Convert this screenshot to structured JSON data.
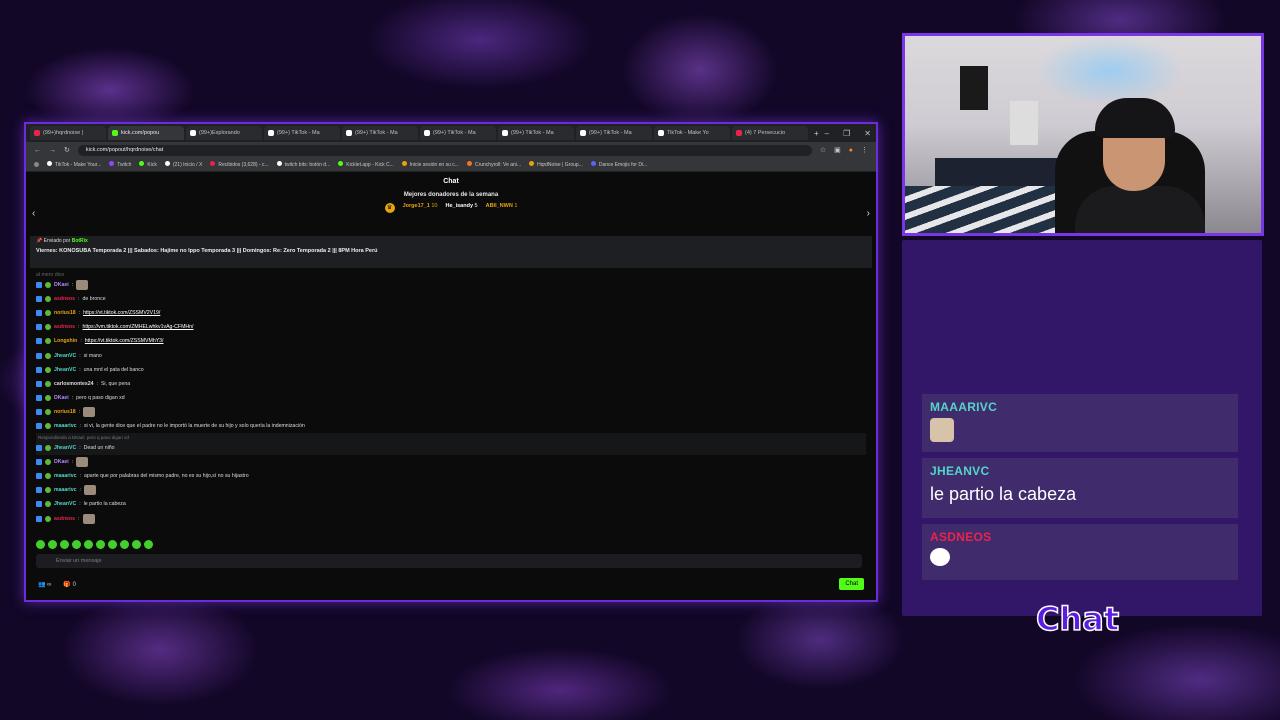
{
  "browser": {
    "tabs": [
      {
        "label": "(99+)hqrdnoise |"
      },
      {
        "label": "kick.com/popou",
        "active": true
      },
      {
        "label": "(99+)Explorando"
      },
      {
        "label": "(99+) TikTok - Ma"
      },
      {
        "label": "(99+) TikTok - Ma"
      },
      {
        "label": "(99+) TikTok - Ma"
      },
      {
        "label": "(99+) TikTok - Ma"
      },
      {
        "label": "(99+) TikTok - Ma"
      },
      {
        "label": "TikTok - Make Yo"
      },
      {
        "label": "(4) 7 Persecucio"
      }
    ],
    "new_tab": "+",
    "url": "kick.com/popout/hqrdnoise/chat",
    "bookmarks": [
      "TikTok - Make Your...",
      "Twitch",
      "Kick",
      "(21) Inicio / X",
      "Recibidos (3,628) - c...",
      "twitch bits: botón d...",
      "Kicklet.app - Kick C...",
      "Inicie sesión en su c...",
      "Crunchyroll: Ve ani...",
      "HqrdNoise | Group...",
      "Dance Emojis for Di..."
    ]
  },
  "chat": {
    "title": "Chat",
    "donors_title": "Mejores donadores de la semana",
    "donors": [
      {
        "name": "Jorge17_1",
        "amount": "10",
        "color": "#e8a40c"
      },
      {
        "name": "He_isandy",
        "amount": "5",
        "color": "#ffffff"
      },
      {
        "name": "ABII_NWN",
        "amount": "1",
        "color": "#e8a40c"
      }
    ],
    "cut_top": "al mero dice",
    "pinned": {
      "sent_by": "Enviado por",
      "bot": "BotRix",
      "message": "Viernes: KONOSUBA Temporada 2 ||| Sabados: Hajime no Ippo Temporada 3 ||| Domingos: Re: Zero Temporada 2 ||| 8PM Hora Perú"
    },
    "messages": [
      {
        "user": "DKaei",
        "color": "#b887ff",
        "text": "",
        "emote": true
      },
      {
        "user": "asdneos",
        "color": "#e8244d",
        "text": "de bronce"
      },
      {
        "user": "norius18",
        "color": "#e8a40c",
        "text": "https://vt.tiktok.com/ZSSMV2V19/",
        "link": true
      },
      {
        "user": "asdneos",
        "color": "#e8244d",
        "text": "https://vm.tiktok.com/ZMHELwhkv1vAg-CFMHn/",
        "link": true
      },
      {
        "user": "Longshin",
        "color": "#e8a40c",
        "text": "https://vt.tiktok.com/ZSSMVMhY3/",
        "link": true
      },
      {
        "user": "JheanVC",
        "color": "#53d6c8",
        "text": "si mano"
      },
      {
        "user": "JheanVC",
        "color": "#53d6c8",
        "text": "una mrd el pata del banco"
      },
      {
        "user": "carlosmontes24",
        "color": "#dddddd",
        "text": "Si, que pena"
      },
      {
        "user": "DKaei",
        "color": "#b887ff",
        "text": "pero q paso digan xd"
      },
      {
        "user": "norius18",
        "color": "#e8a40c",
        "text": "",
        "emote": true
      },
      {
        "user": "maaarivc",
        "color": "#53d6c8",
        "text": "si vi, la gente dice que el padre no le importó la muerte de su hijo y solo quería la indemnización"
      },
      {
        "user": "JheanVC",
        "color": "#53d6c8",
        "text": "Dead un niño",
        "reply": "Respondiendo a DKaei: pero q paso digan xd"
      },
      {
        "user": "DKaei",
        "color": "#b887ff",
        "text": "",
        "emote": true
      },
      {
        "user": "maaarivc",
        "color": "#53d6c8",
        "text": "aparte que por palabras del mismo padre, no es su hijo,sí no su hijastro"
      },
      {
        "user": "maaarivc",
        "color": "#53d6c8",
        "text": "",
        "emote": true
      },
      {
        "user": "JheanVC",
        "color": "#53d6c8",
        "text": "le partio la cabeza"
      },
      {
        "user": "asdneos",
        "color": "#e8244d",
        "text": "",
        "emote": true
      }
    ],
    "input_placeholder": "Enviar un mensaje",
    "viewers": "∞",
    "count": "0",
    "send_label": "Chat"
  },
  "overlay": {
    "messages": [
      {
        "user": "MAAARIVC",
        "color": "#53d6c8",
        "text": "",
        "emote": true
      },
      {
        "user": "JHEANVC",
        "color": "#53d6c8",
        "text": "le partio la cabeza"
      },
      {
        "user": "ASDNEOS",
        "color": "#e8244d",
        "text": "",
        "emote": true
      }
    ],
    "label": "Chat"
  }
}
